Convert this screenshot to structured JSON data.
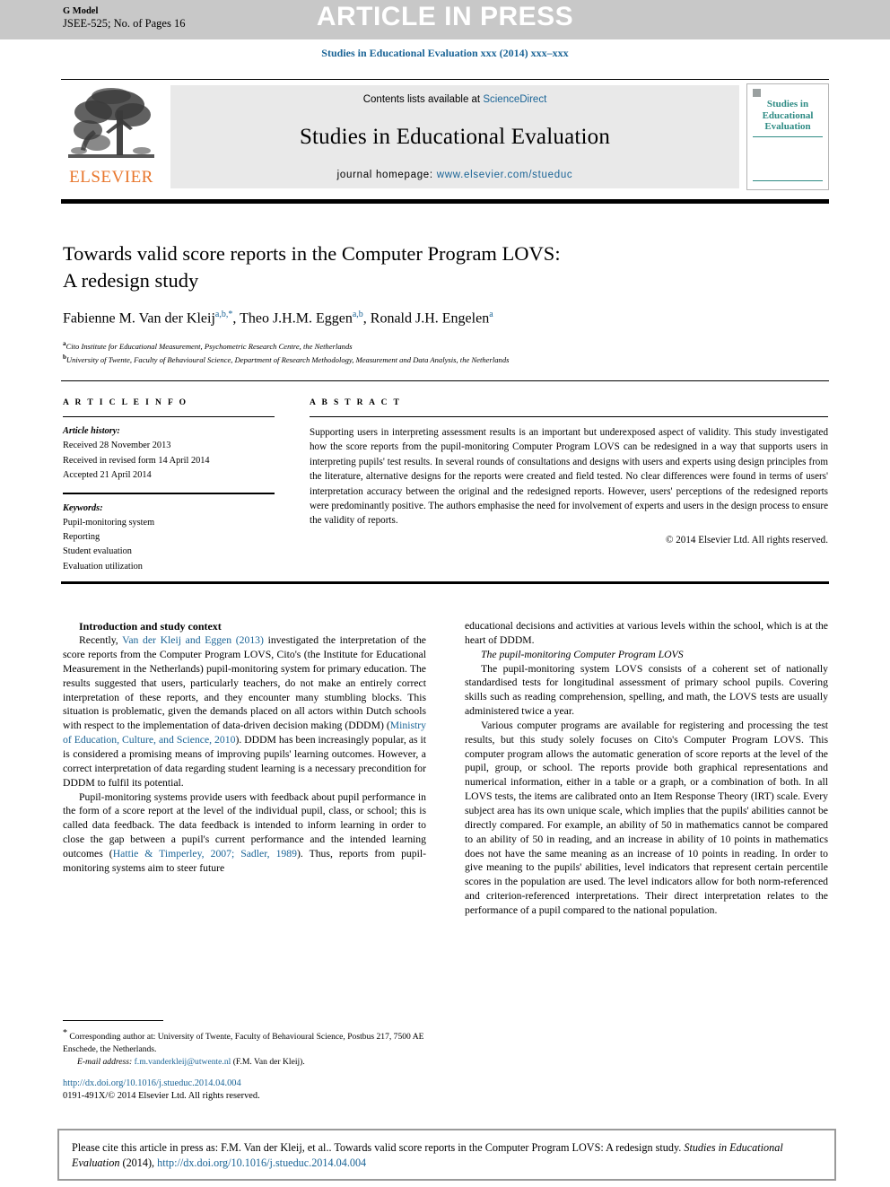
{
  "header": {
    "g_model_label": "G Model",
    "article_id": "JSEE-525; No. of Pages 16",
    "status_banner": "ARTICLE IN PRESS",
    "journal_running_head": "Studies in Educational Evaluation xxx (2014) xxx–xxx",
    "banner_bg": "#c8c8c8",
    "link_color": "#1a6496"
  },
  "masthead": {
    "publisher": "ELSEVIER",
    "publisher_color": "#e8762c",
    "contents_prefix": "Contents lists available at",
    "contents_link": "ScienceDirect",
    "journal_title": "Studies in Educational Evaluation",
    "homepage_label": "journal homepage:",
    "homepage_url": "www.elsevier.com/stueduc",
    "cover_title": "Studies in Educational Evaluation",
    "cover_accent": "#2e8b84"
  },
  "article": {
    "title_line1": "Towards valid score reports in the Computer Program LOVS:",
    "title_line2": "A redesign study",
    "authors": [
      {
        "name": "Fabienne M. Van der Kleij",
        "sup": "a,b,*"
      },
      {
        "name": "Theo J.H.M. Eggen",
        "sup": "a,b"
      },
      {
        "name": "Ronald J.H. Engelen",
        "sup": "a"
      }
    ],
    "affiliations": [
      {
        "marker": "a",
        "text": "Cito Institute for Educational Measurement, Psychometric Research Centre, the Netherlands"
      },
      {
        "marker": "b",
        "text": "University of Twente, Faculty of Behavioural Science, Department of Research Methodology, Measurement and Data Analysis, the Netherlands"
      }
    ]
  },
  "info": {
    "heading": "A R T I C L E   I N F O",
    "history_label": "Article history:",
    "history": [
      "Received 28 November 2013",
      "Received in revised form 14 April 2014",
      "Accepted 21 April 2014"
    ],
    "keywords_label": "Keywords:",
    "keywords": [
      "Pupil-monitoring system",
      "Reporting",
      "Student evaluation",
      "Evaluation utilization"
    ]
  },
  "abstract": {
    "heading": "A B S T R A C T",
    "text": "Supporting users in interpreting assessment results is an important but underexposed aspect of validity. This study investigated how the score reports from the pupil-monitoring Computer Program LOVS can be redesigned in a way that supports users in interpreting pupils' test results. In several rounds of consultations and designs with users and experts using design principles from the literature, alternative designs for the reports were created and field tested. No clear differences were found in terms of users' interpretation accuracy between the original and the redesigned reports. However, users' perceptions of the redesigned reports were predominantly positive. The authors emphasise the need for involvement of experts and users in the design process to ensure the validity of reports.",
    "copyright": "© 2014 Elsevier Ltd. All rights reserved."
  },
  "body": {
    "left": {
      "section_heading": "Introduction and study context",
      "para1_a": "Recently, ",
      "para1_cite1": "Van der Kleij and Eggen (2013)",
      "para1_b": " investigated the interpretation of the score reports from the Computer Program LOVS, Cito's (the Institute for Educational Measurement in the Netherlands) pupil-monitoring system for primary education. The results suggested that users, particularly teachers, do not make an entirely correct interpretation of these reports, and they encounter many stumbling blocks. This situation is problematic, given the demands placed on all actors within Dutch schools with respect to the implementation of data-driven decision making (DDDM) (",
      "para1_cite2": "Ministry of Education, Culture, and Science, 2010",
      "para1_c": "). DDDM has been increasingly popular, as it is considered a promising means of improving pupils' learning outcomes. However, a correct interpretation of data regarding student learning is a necessary precondition for DDDM to fulfil its potential.",
      "para2_a": "Pupil-monitoring systems provide users with feedback about pupil performance in the form of a score report at the level of the individual pupil, class, or school; this is called data feedback. The data feedback is intended to inform learning in order to close the gap between a pupil's current performance and the intended learning outcomes (",
      "para2_cite": "Hattie & Timperley, 2007; Sadler, 1989",
      "para2_b": "). Thus, reports from pupil-monitoring systems aim to steer future"
    },
    "right": {
      "para_cont": "educational decisions and activities at various levels within the school, which is at the heart of DDDM.",
      "subheading": "The pupil-monitoring Computer Program LOVS",
      "para1": "The pupil-monitoring system LOVS consists of a coherent set of nationally standardised tests for longitudinal assessment of primary school pupils. Covering skills such as reading comprehension, spelling, and math, the LOVS tests are usually administered twice a year.",
      "para2": "Various computer programs are available for registering and processing the test results, but this study solely focuses on Cito's Computer Program LOVS. This computer program allows the automatic generation of score reports at the level of the pupil, group, or school. The reports provide both graphical representations and numerical information, either in a table or a graph, or a combination of both. In all LOVS tests, the items are calibrated onto an Item Response Theory (IRT) scale. Every subject area has its own unique scale, which implies that the pupils' abilities cannot be directly compared. For example, an ability of 50 in mathematics cannot be compared to an ability of 50 in reading, and an increase in ability of 10 points in mathematics does not have the same meaning as an increase of 10 points in reading. In order to give meaning to the pupils' abilities, level indicators that represent certain percentile scores in the population are used. The level indicators allow for both norm-referenced and criterion-referenced interpretations. Their direct interpretation relates to the performance of a pupil compared to the national population."
    }
  },
  "footnote": {
    "corresponding_marker": "*",
    "corresponding_text": "Corresponding author at: University of Twente, Faculty of Behavioural Science, Postbus 217, 7500 AE Enschede, the Netherlands.",
    "email_label": "E-mail address:",
    "email": "f.m.vanderkleij@utwente.nl",
    "email_owner": "(F.M. Van der Kleij).",
    "doi_url": "http://dx.doi.org/10.1016/j.stueduc.2014.04.004",
    "issn_line": "0191-491X/© 2014 Elsevier Ltd. All rights reserved."
  },
  "cite_box": {
    "prefix": "Please cite this article in press as: F.M. Van der Kleij, et al.. Towards valid score reports in the Computer Program LOVS: A redesign study.",
    "journal": "Studies in Educational Evaluation",
    "year": "(2014),",
    "doi": "http://dx.doi.org/10.1016/j.stueduc.2014.04.004"
  }
}
